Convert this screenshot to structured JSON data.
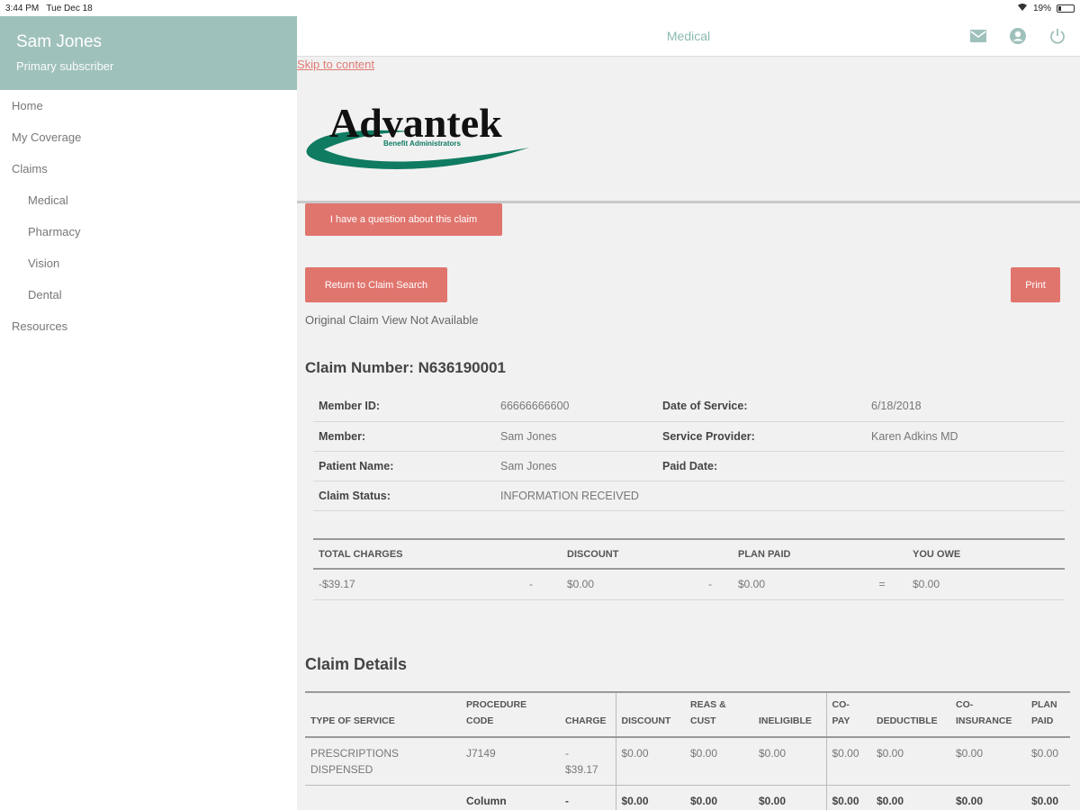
{
  "status_bar": {
    "time": "3:44 PM",
    "date": "Tue Dec 18",
    "battery": "19%"
  },
  "sidebar": {
    "user_name": "Sam Jones",
    "user_role": "Primary subscriber",
    "items": [
      {
        "label": "Home"
      },
      {
        "label": "My Coverage"
      },
      {
        "label": "Claims"
      },
      {
        "label": "Medical"
      },
      {
        "label": "Pharmacy"
      },
      {
        "label": "Vision"
      },
      {
        "label": "Dental"
      },
      {
        "label": "Resources"
      }
    ]
  },
  "header": {
    "title": "Medical",
    "icons": [
      "mail-icon",
      "account-icon",
      "power-icon"
    ]
  },
  "skip_link": "Skip to content",
  "logo": {
    "name": "Advantek",
    "tagline": "Benefit Administrators"
  },
  "buttons": {
    "question": "I have a question about this claim",
    "return": "Return to Claim Search",
    "print": "Print"
  },
  "note": "Original Claim View Not Available",
  "claim_number": "Claim Number: N636190001",
  "info": {
    "member_id_label": "Member ID:",
    "member_id": "66666666600",
    "date_of_service_label": "Date of Service:",
    "date_of_service": "6/18/2018",
    "member_label": "Member:",
    "member": "Sam Jones",
    "service_provider_label": "Service Provider:",
    "service_provider": "Karen Adkins MD",
    "patient_name_label": "Patient Name:",
    "patient_name": "Sam Jones",
    "paid_date_label": "Paid Date:",
    "paid_date": "",
    "claim_status_label": "Claim Status:",
    "claim_status": "INFORMATION RECEIVED"
  },
  "totals": {
    "headers": [
      "TOTAL CHARGES",
      "DISCOUNT",
      "PLAN PAID",
      "YOU OWE"
    ],
    "total_charges": "-$39.17",
    "op1": "-",
    "discount": "$0.00",
    "op2": "-",
    "plan_paid": "$0.00",
    "op3": "=",
    "you_owe": "$0.00"
  },
  "details": {
    "title": "Claim Details",
    "headers": {
      "type": "TYPE OF SERVICE",
      "proc_1": "PROCEDURE",
      "proc_2": "CODE",
      "charge": "CHARGE",
      "discount": "DISCOUNT",
      "reas_1": "REAS &",
      "reas_2": "CUST",
      "ineligible": "INELIGIBLE",
      "copay_1": "CO-",
      "copay_2": "PAY",
      "deductible": "DEDUCTIBLE",
      "coins_1": "CO-",
      "coins_2": "INSURANCE",
      "plan_1": "PLAN",
      "plan_2": "PAID"
    },
    "row": {
      "type_1": "PRESCRIPTIONS",
      "type_2": "DISPENSED",
      "proc": "J7149",
      "charge_1": "-",
      "charge_2": "$39.17",
      "discount": "$0.00",
      "reas": "$0.00",
      "ineligible": "$0.00",
      "copay": "$0.00",
      "deductible": "$0.00",
      "coins": "$0.00",
      "plan": "$0.00"
    },
    "total_row": {
      "label": "Column",
      "charge": "-",
      "discount": "$0.00",
      "reas": "$0.00",
      "ineligible": "$0.00",
      "copay": "$0.00",
      "deductible": "$0.00",
      "coins": "$0.00",
      "plan": "$0.00"
    }
  },
  "colors": {
    "accent": "#9fc1bb",
    "button": "#e0756e",
    "link": "#e07a73"
  }
}
